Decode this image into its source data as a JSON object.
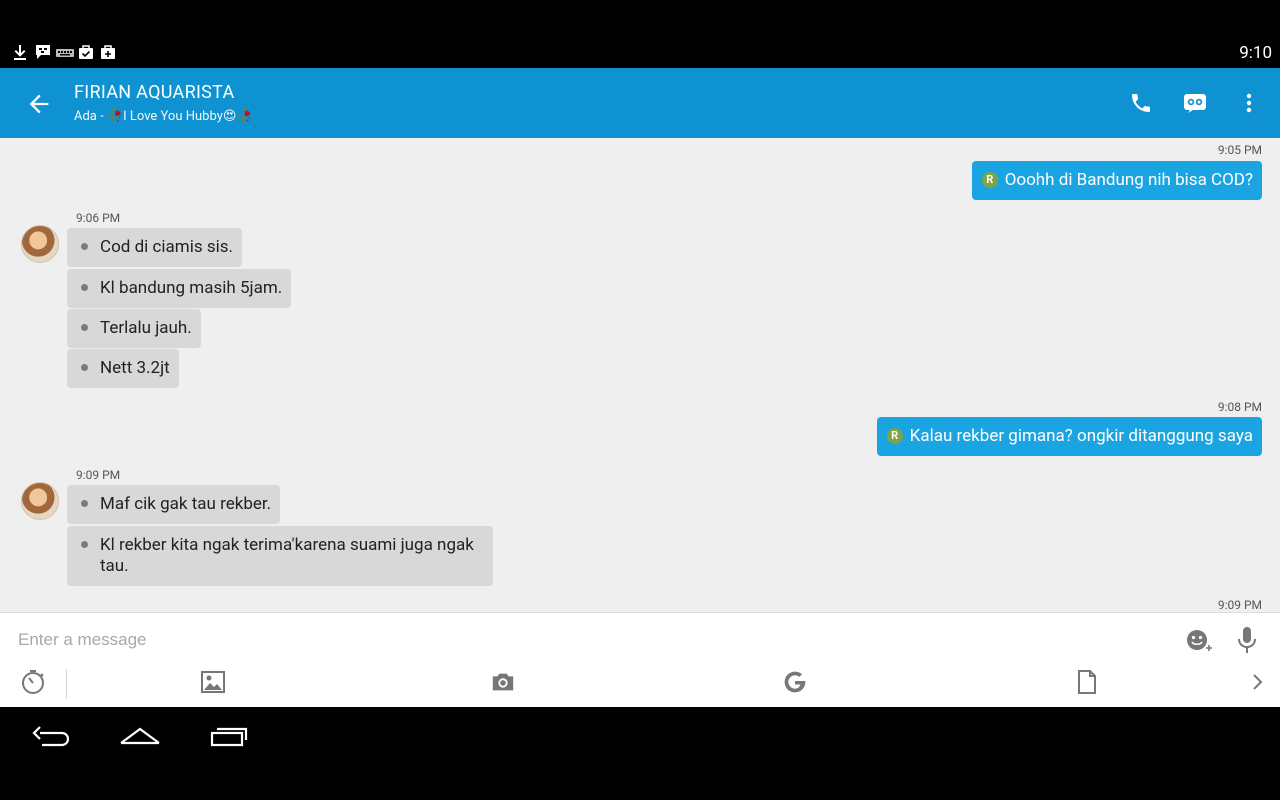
{
  "status_bar": {
    "time": "9:10",
    "icons": [
      "download-icon",
      "bbm-notification-icon",
      "keyboard-icon",
      "bag-check-icon",
      "bag-icon"
    ]
  },
  "header": {
    "title": "FIRIAN AQUARISTA",
    "subtitle": "Ada - 🥀I Love You Hubby😍🥀",
    "actions": [
      "phone-icon",
      "video-icon",
      "more-icon"
    ]
  },
  "messages": [
    {
      "time": "9:05 PM",
      "side": "sent",
      "badge": "R",
      "items": [
        "Ooohh di Bandung nih bisa COD?"
      ]
    },
    {
      "time": "9:06 PM",
      "side": "received",
      "items": [
        "Cod di ciamis sis.",
        "Kl bandung masih 5jam.",
        "Terlalu jauh.",
        "Nett 3.2jt"
      ]
    },
    {
      "time": "9:08 PM",
      "side": "sent",
      "badge": "R",
      "items": [
        "Kalau rekber gimana? ongkir ditanggung saya"
      ]
    },
    {
      "time": "9:09 PM",
      "side": "received",
      "items": [
        "Maf cik gak tau rekber.",
        "Kl rekber kita ngak terima'karena suami juga ngak tau."
      ]
    },
    {
      "time": "9:09 PM",
      "side": "sent",
      "items": []
    }
  ],
  "composer": {
    "placeholder": "Enter a message"
  },
  "colors": {
    "appbar": "#0e92d1",
    "sent_bubble": "#1aa5e2",
    "received_bubble": "#d8d8d8",
    "chat_bg": "#efefef"
  }
}
